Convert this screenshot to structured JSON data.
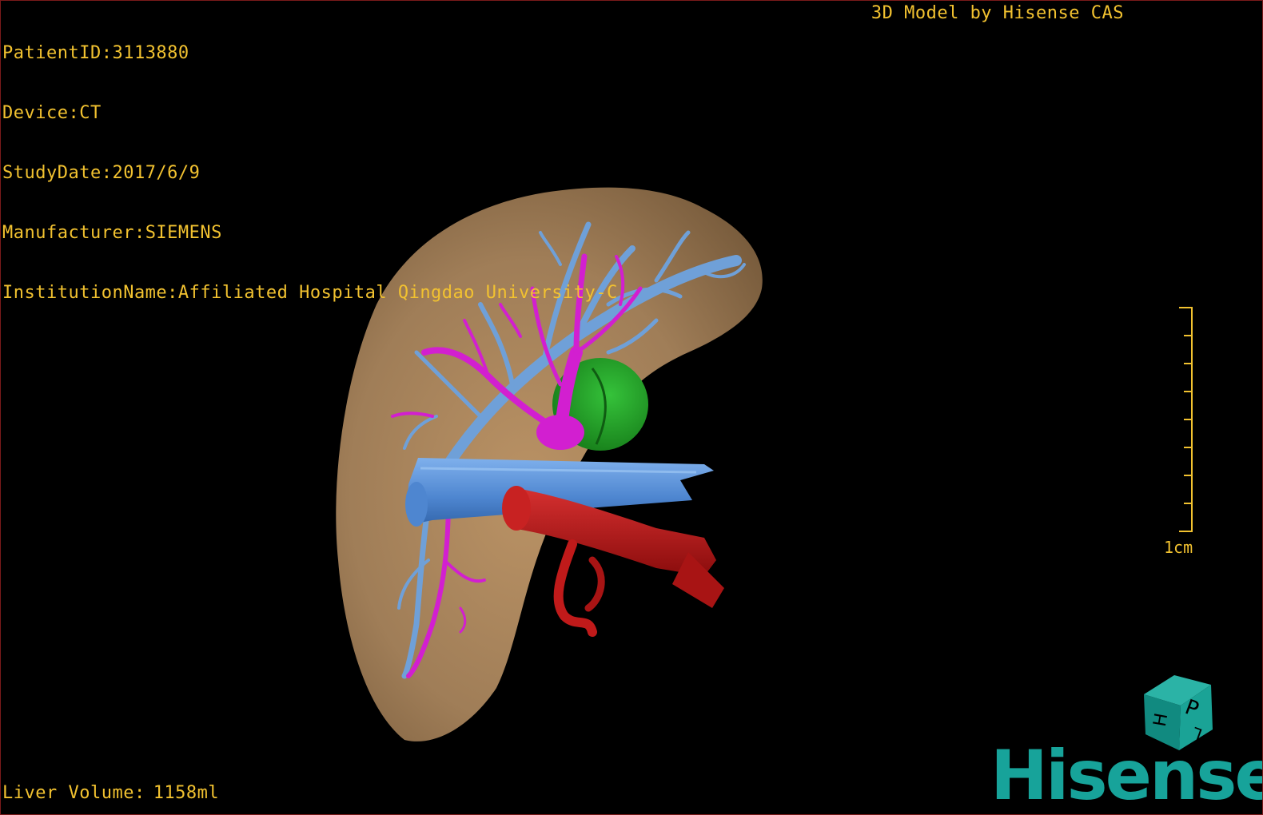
{
  "study_info": {
    "patient_id_label": "PatientID:",
    "patient_id": "3113880",
    "device_label": "Device:",
    "device": "CT",
    "study_date_label": "StudyDate:",
    "study_date": "2017/6/9",
    "manufacturer_label": "Manufacturer:",
    "manufacturer": "SIEMENS",
    "institution_label": "InstitutionName:",
    "institution": "Affiliated Hospital Qingdao University-C"
  },
  "model_credit": "3D Model by Hisense CAS",
  "liver_volume": {
    "label": "Liver Volume:",
    "value": "1158ml"
  },
  "scale": {
    "label": "1cm"
  },
  "orientation_cube": {
    "faces": [
      "P",
      "H",
      "L"
    ]
  },
  "brand": "Hisense",
  "colors": {
    "text_overlay": "#f2c230",
    "liver": "#a8845c",
    "hepatic_vein": "#6fa0d8",
    "portal_vein": "#d21fd0",
    "vena_cava": "#5a8fd6",
    "artery": "#b8181a",
    "gallbladder": "#1f9a22",
    "brand": "#17a39a",
    "border": "#7a1a1a"
  },
  "icons": {
    "orientation": "orientation-cube-icon",
    "logo": "hisense-logo"
  }
}
